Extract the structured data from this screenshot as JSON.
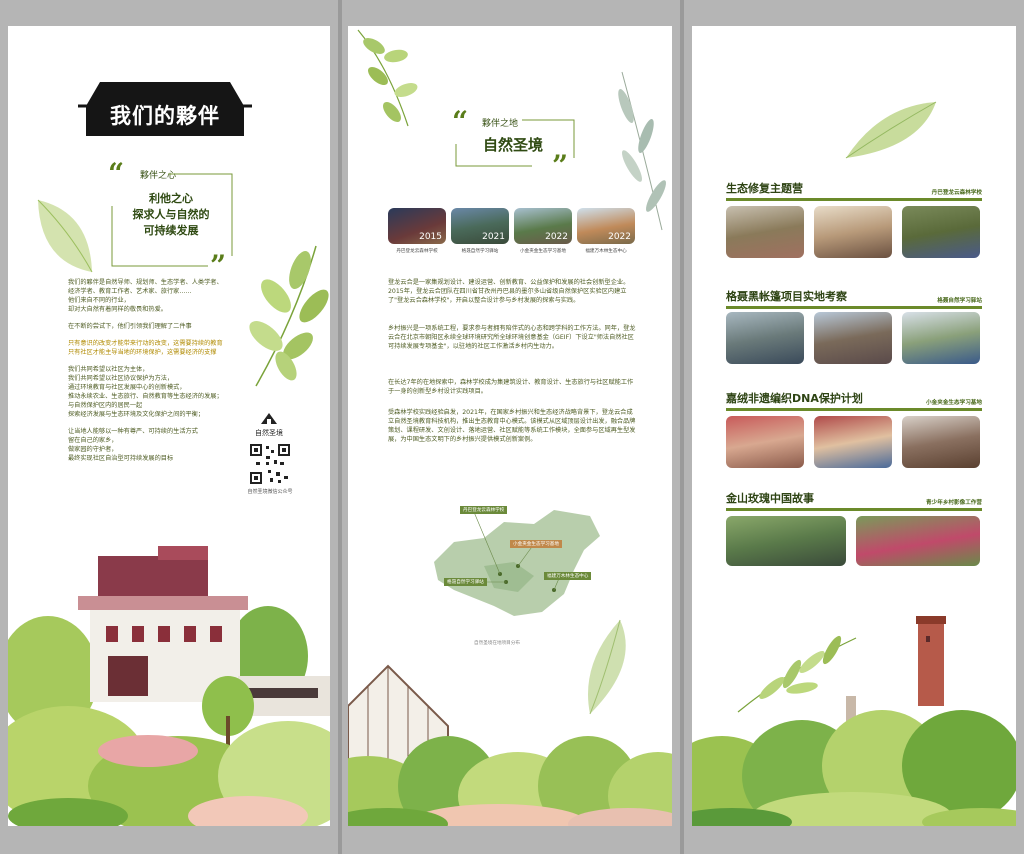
{
  "panel1": {
    "banner_title": "我们的夥伴",
    "quote_subtitle": "夥伴之心",
    "quote_lines": [
      "利他之心",
      "探求人与自然的",
      "可持续发展"
    ],
    "intro": [
      "我们的夥伴是自然导师、规划师、生态学者、人类学者、",
      "经济学者、教育工作者、艺术家、旅行家……",
      "他们来自不同的行业，",
      "却对大自然有着同样的敬畏和热爱。"
    ],
    "try_line": "在不断的尝试下，他们引领我们理解了二件事",
    "highlight": [
      "只有意识的改变才能带来行动的改变，这需要持续的教育",
      "只有社区才能主导当地的环境保护，这需要经济的支撑"
    ],
    "hope": [
      "我们共同希望以社区为主体，",
      "我们共同希望以社区协议保护为方法，",
      "通过环境教育与社区发展中心的创新模式，",
      "推动永续农业、生态旅行、自然教育等生态经济的发展；",
      "与自然保护区内的居民一起",
      "探索经济发展与生态环境及文化保护之间的平衡；"
    ],
    "closing": [
      "让当地人能够以一种有尊严、可持续的生活方式",
      "留在自己的家乡，",
      "做家园的守护者，",
      "最终实现社区自治型可持续发展的目标"
    ],
    "logo_text": "自然圣境",
    "qr_caption": "自然圣境微信公众号"
  },
  "panel2": {
    "quote_subtitle": "夥伴之地",
    "quote_title": "自然圣境",
    "timeline": [
      {
        "year": "2015",
        "caption": "丹巴登龙云森林学校"
      },
      {
        "year": "2021",
        "caption": "格聂自然学习驿站"
      },
      {
        "year": "2022",
        "caption": "小金夹金生态学习基地"
      },
      {
        "year": "2022",
        "caption": "福建万木林生态中心"
      }
    ],
    "paragraphs": [
      "登龙云合是一家集规划设计、建设运营、创新教育、公益保护和发展的社会创新型企业。2015年，登龙云合团队在四川省甘孜州丹巴县的墨尔多山省级自然保护区实验区内建立了\"登龙云合森林学校\"，开启以整合设计参与乡村发展的探索与实践。",
      "乡村振兴是一项系统工程，要求参与者拥有陪伴式的心态和跨学科的工作方法。同年，登龙云合在北京市朝阳区永续全球环境研究所全球环境创意基金（GEIF）下设立\"师法自然社区可持续发展专项基金\"，以驻地的社区工作激活乡村内生动力。",
      "在长达7年的在地探索中，森林学校成为集建筑设计、教育设计、生态旅行与社区赋能工作于一身的创新型乡村设计实践项目。",
      "受森林学校实践经验启发，2021年，在国家乡村振兴和生态经济战略背景下，登龙云合成立自然圣境教育科技机构，推出生态教育中心模式。该模式从区域顶层设计出发，融合品牌策划、课程研发、文创设计、落地运营、社区赋能等系统工作模块，全面参与区域再生型发展，为中国生态文明下的乡村振兴提供模式创新案例。"
    ],
    "map_labels": [
      "丹巴登龙云森林学校",
      "小金夹金生态学习基地",
      "格聂自然学习驿站",
      "福建万木林生态中心"
    ],
    "map_caption": "自然圣境在地项目分布"
  },
  "panel3": {
    "sections": [
      {
        "title": "生态修复主题营",
        "tag": "丹巴登龙云森林学校"
      },
      {
        "title": "格聂黑帐篷项目实地考察",
        "tag": "格聂自然学习驿站"
      },
      {
        "title": "嘉绒非遗编织DNA保护计划",
        "tag": "小金夹金生态学习基地"
      },
      {
        "title": "金山玫瑰中国故事",
        "tag": "青少年乡村影像工作营"
      }
    ]
  },
  "colors": {
    "accent_green": "#5a7d1a",
    "highlight": "#b08a00",
    "dark": "#1a1a1a"
  }
}
